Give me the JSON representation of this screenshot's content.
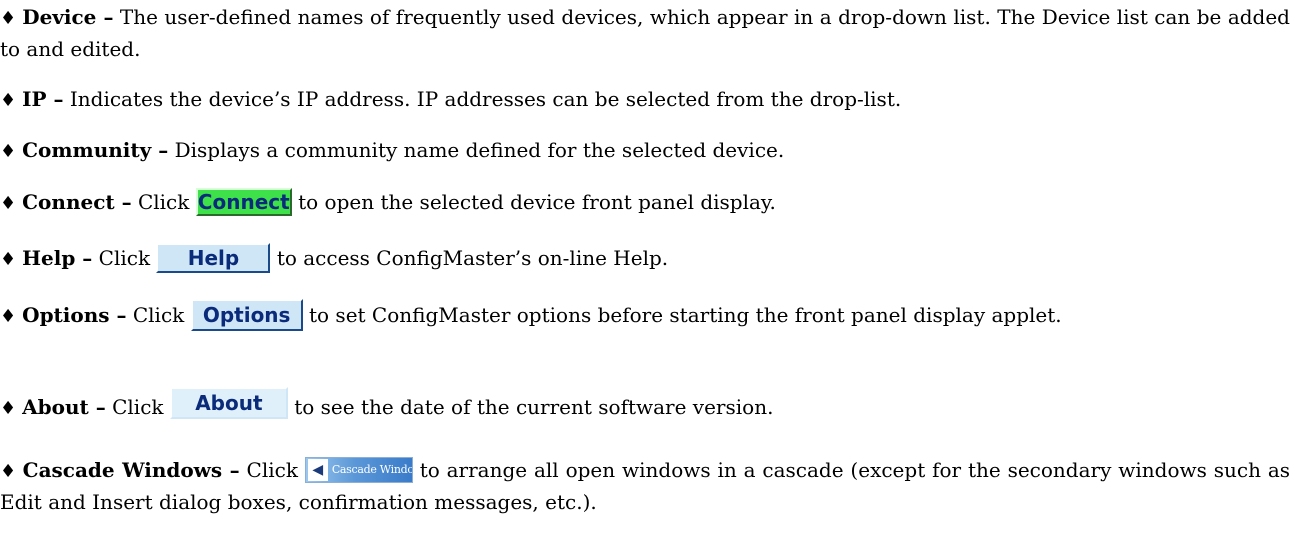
{
  "bullet_symbol": "♦",
  "items": [
    {
      "term": "Device –",
      "text": "The user-defined names of frequently used devices, which appear in a drop-down list. The Device list can be added to and edited."
    },
    {
      "term": "IP –",
      "text": "Indicates the device’s IP address. IP addresses can be selected from the drop-list."
    },
    {
      "term": "Community –",
      "text": "Displays a community name defined for the selected device."
    },
    {
      "term": "Connect –",
      "prefix": "Click",
      "button_label": "Connect",
      "text": "to open the selected device front panel display."
    },
    {
      "term": "Help –",
      "prefix": "Click",
      "button_label": "Help",
      "text": "to access ConfigMaster’s on-line Help."
    },
    {
      "term": "Options –",
      "prefix": "Click",
      "button_label": "Options",
      "text": "to set ConfigMaster options before starting the front panel display applet."
    },
    {
      "term": "About –",
      "prefix": "Click",
      "button_label": "About",
      "text": "to see the date of the current software version."
    },
    {
      "term": "Cascade Windows –",
      "prefix": "Click",
      "button_label": "Cascade Windows",
      "button_icon": "left-arrow-icon",
      "text": "to arrange all open windows in a cascade (except for the secondary windows such as Edit and Insert dialog boxes, confirmation messages, etc.)."
    }
  ],
  "colors": {
    "connect_button": "#3ee14a",
    "blue_button": "#cfe6f7",
    "button_text": "#0a2a7a",
    "cascade_button": "#3a7bc9"
  }
}
